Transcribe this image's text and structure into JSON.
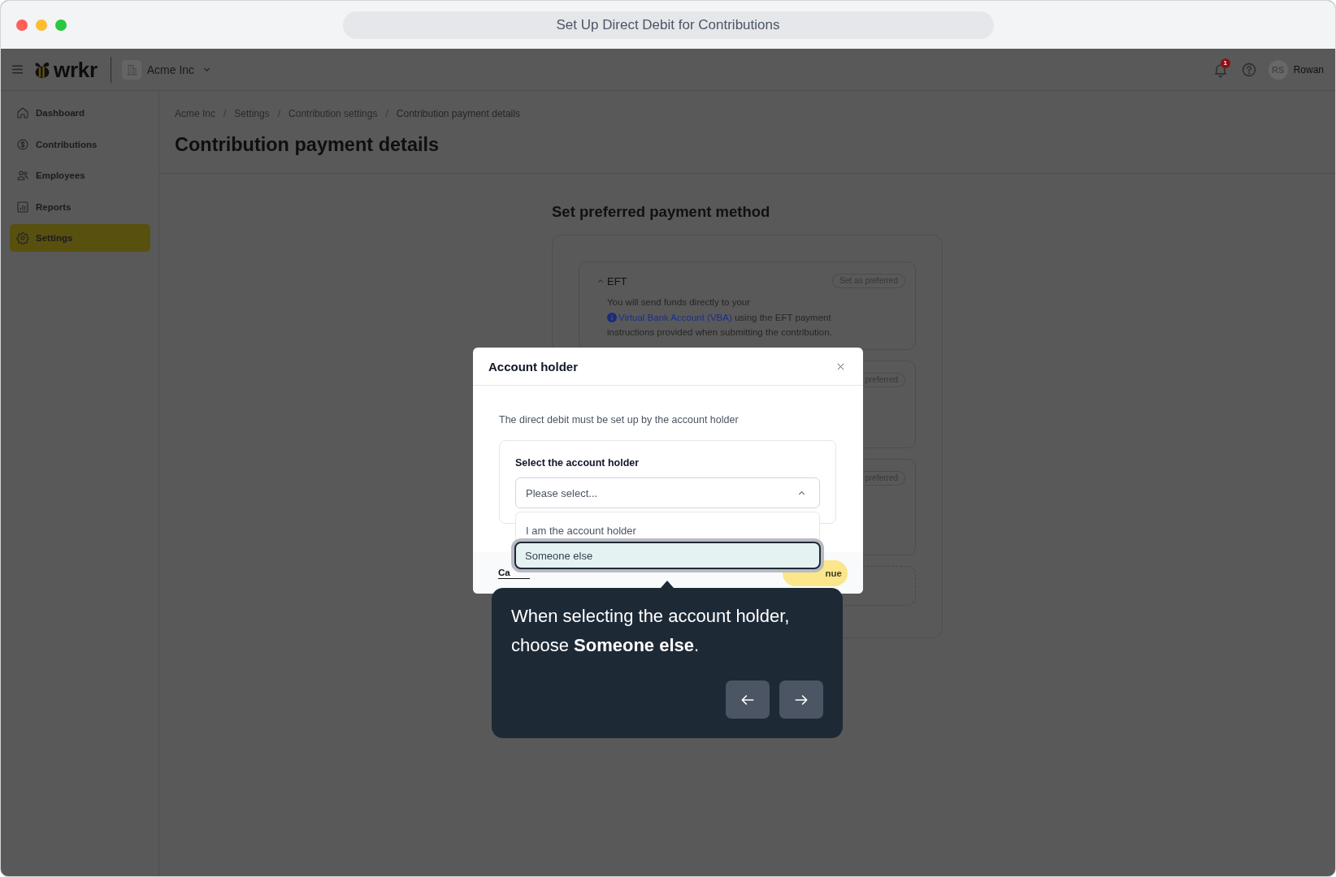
{
  "window": {
    "title": "Set Up Direct Debit for Contributions"
  },
  "header": {
    "logo": "wrkr",
    "company": "Acme Inc",
    "notification_count": "1",
    "avatar_initials": "RS",
    "user_name": "Rowan"
  },
  "sidebar": {
    "items": [
      {
        "label": "Dashboard",
        "selected": false
      },
      {
        "label": "Contributions",
        "selected": false
      },
      {
        "label": "Employees",
        "selected": false
      },
      {
        "label": "Reports",
        "selected": false
      },
      {
        "label": "Settings",
        "selected": true
      }
    ]
  },
  "breadcrumb": [
    {
      "kind": "link",
      "text": "Acme Inc"
    },
    {
      "kind": "separator",
      "text": "/"
    },
    {
      "kind": "link",
      "text": "Settings"
    },
    {
      "kind": "separator",
      "text": "/"
    },
    {
      "kind": "link",
      "text": "Contribution settings"
    },
    {
      "kind": "separator",
      "text": "/"
    },
    {
      "kind": "current",
      "text": "Contribution payment details"
    }
  ],
  "page_title": "Contribution payment details",
  "section_title": "Set preferred payment method",
  "payment_methods": [
    {
      "kind": "option",
      "title": "EFT",
      "expanded": true,
      "preferred_button": "Set as preferred",
      "description": "You will send funds directly to your",
      "link": "Virtual Bank Account (VBA)",
      "description_end": "using the EFT payment instructions provided when submitting the contribution."
    },
    {
      "kind": "covered",
      "preferred_button": "preferred"
    },
    {
      "kind": "covered",
      "preferred_button": "preferred"
    },
    {
      "kind": "dashed"
    }
  ],
  "modal": {
    "title": "Account holder",
    "message": "The direct debit must be set up by the account holder",
    "field": {
      "label": "Select the account holder",
      "placeholder": "Please select...",
      "open": true,
      "options": [
        {
          "label": "I am the account holder",
          "highlighted": false
        },
        {
          "label": "Someone else",
          "highlighted": true
        }
      ]
    },
    "cancel": "Ca",
    "continue": "nue"
  },
  "tour": {
    "text": "When selecting the account holder, choose **Someone else**."
  }
}
